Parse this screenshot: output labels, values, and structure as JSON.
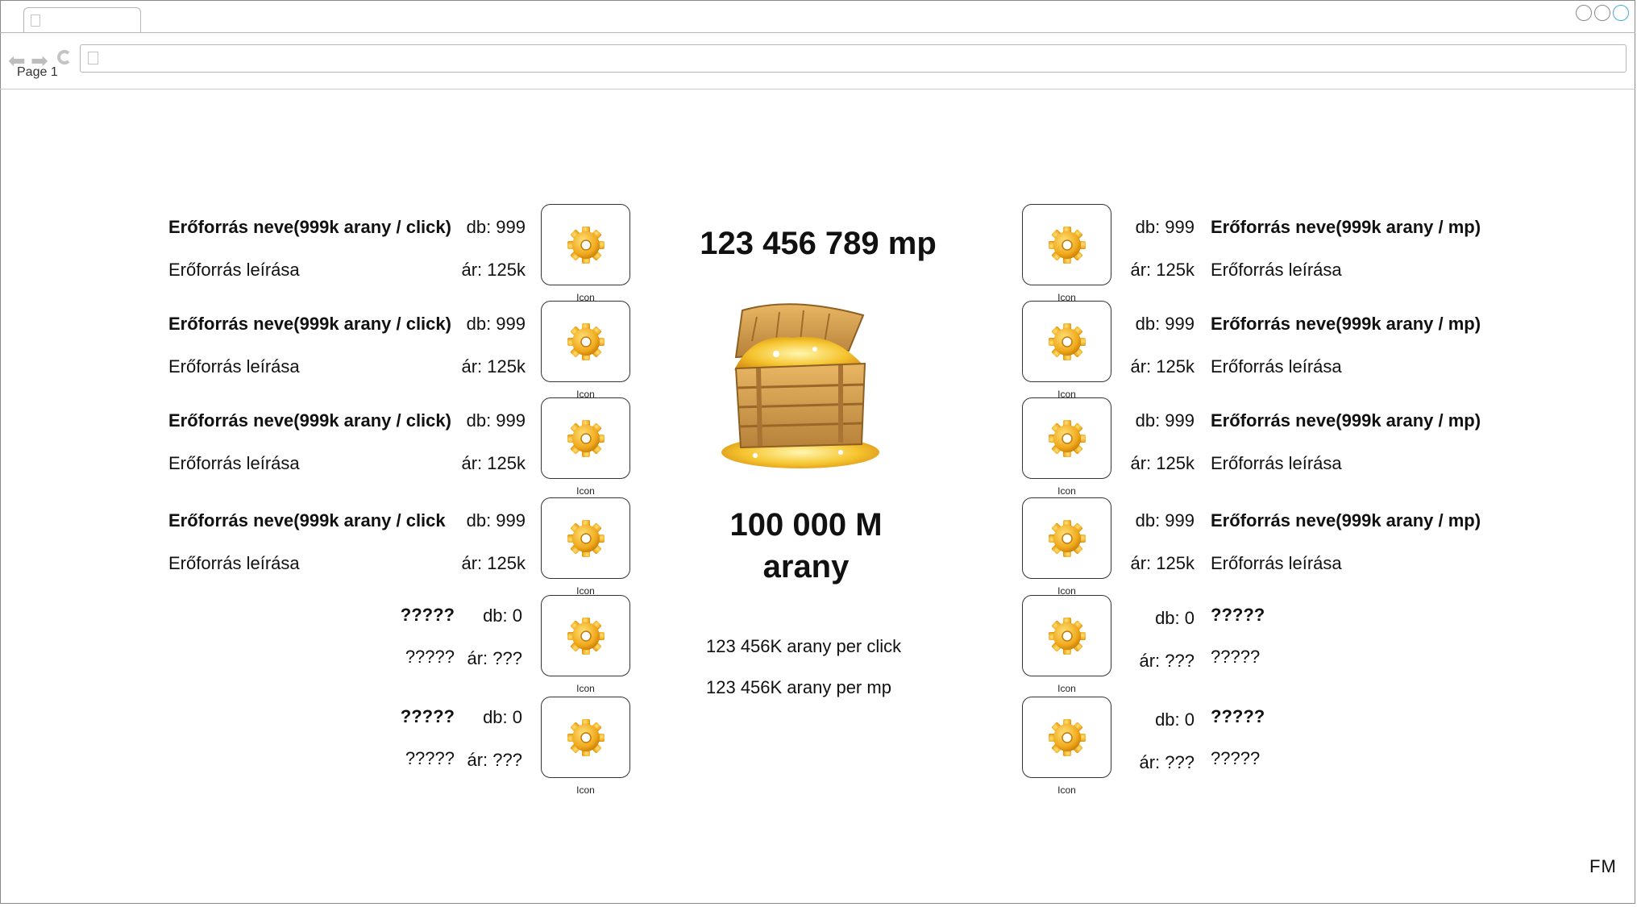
{
  "browser": {
    "page_label": "Page 1"
  },
  "icon_caption": "Icon",
  "center": {
    "time": "123 456 789 mp",
    "gold_line1": "100 000 M",
    "gold_line2": "arany",
    "per_click": "123 456K arany per click",
    "per_sec": "123 456K arany per mp"
  },
  "left_items": [
    {
      "name": "Erőforrás neve(999k arany / click)",
      "count": "db: 999",
      "desc": "Erőforrás leírása",
      "price": "ár: 125k"
    },
    {
      "name": "Erőforrás neve(999k arany / click)",
      "count": "db: 999",
      "desc": "Erőforrás leírása",
      "price": "ár: 125k"
    },
    {
      "name": "Erőforrás neve(999k arany / click)",
      "count": "db: 999",
      "desc": "Erőforrás leírása",
      "price": "ár: 125k"
    },
    {
      "name": "Erőforrás neve(999k arany / click",
      "count": "db: 999",
      "desc": "Erőforrás leírása",
      "price": "ár: 125k"
    },
    {
      "name": "?????",
      "count": "db: 0",
      "desc": "?????",
      "price": "ár: ???"
    },
    {
      "name": "?????",
      "count": "db: 0",
      "desc": "?????",
      "price": "ár: ???"
    }
  ],
  "right_items": [
    {
      "name": "Erőforrás neve(999k arany / mp)",
      "count": "db: 999",
      "desc": "Erőforrás leírása",
      "price": "ár: 125k"
    },
    {
      "name": "Erőforrás neve(999k arany / mp)",
      "count": "db: 999",
      "desc": "Erőforrás leírása",
      "price": "ár: 125k"
    },
    {
      "name": "Erőforrás neve(999k arany / mp)",
      "count": "db: 999",
      "desc": "Erőforrás leírása",
      "price": "ár: 125k"
    },
    {
      "name": "Erőforrás neve(999k arany / mp)",
      "count": "db: 999",
      "desc": "Erőforrás leírása",
      "price": "ár: 125k"
    },
    {
      "name": "?????",
      "count": "db: 0",
      "desc": "?????",
      "price": "ár: ???"
    },
    {
      "name": "?????",
      "count": "db: 0",
      "desc": "?????",
      "price": "ár: ???"
    }
  ],
  "footer": {
    "initials": "FM"
  },
  "icons": {
    "item_icon": "gear-icon",
    "center_image": "treasure-chest"
  }
}
